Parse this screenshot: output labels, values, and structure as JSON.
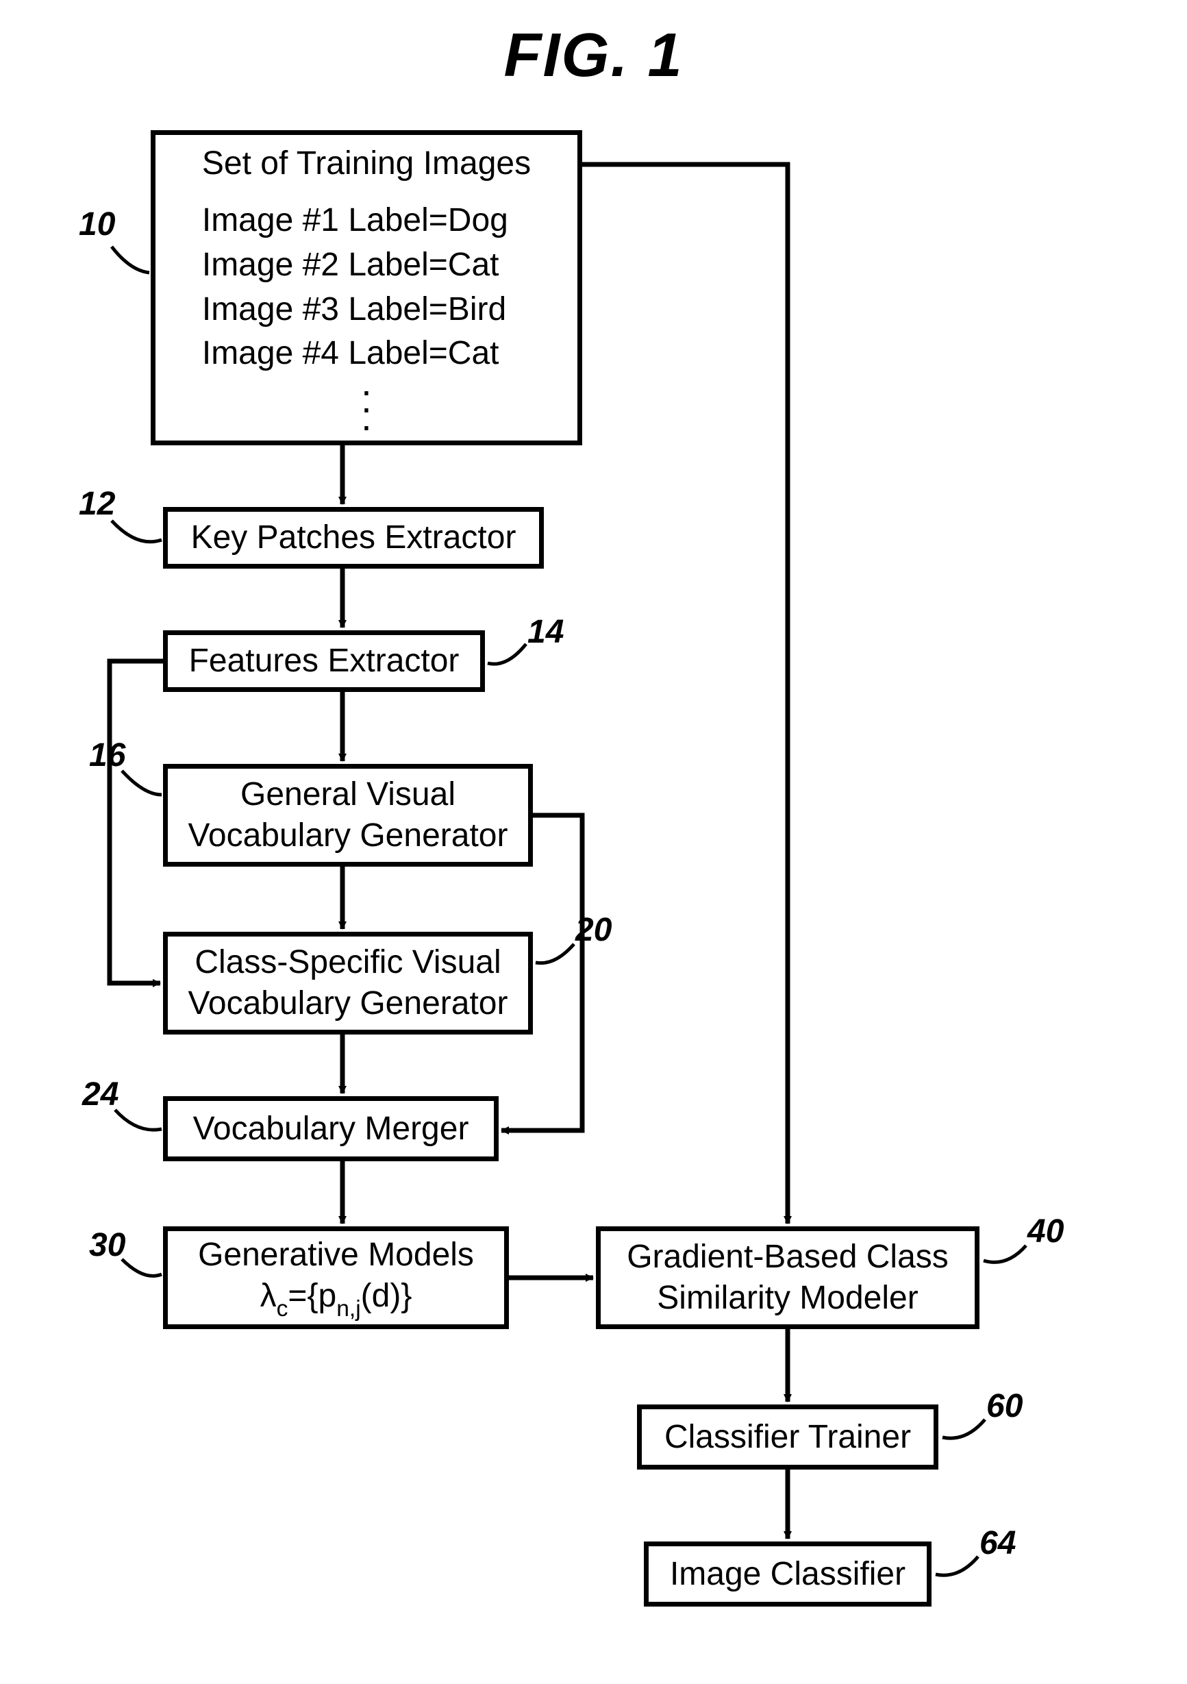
{
  "figure_title": "FIG. 1",
  "refs": {
    "r10": "10",
    "r12": "12",
    "r14": "14",
    "r16": "16",
    "r20": "20",
    "r24": "24",
    "r30": "30",
    "r40": "40",
    "r60": "60",
    "r64": "64"
  },
  "boxes": {
    "training_heading": "Set of Training Images",
    "training_lines": [
      "Image #1  Label=Dog",
      "Image #2  Label=Cat",
      "Image #3  Label=Bird",
      "Image #4  Label=Cat"
    ],
    "key_patches": "Key Patches Extractor",
    "features": "Features Extractor",
    "gen_vocab_l1": "General Visual",
    "gen_vocab_l2": "Vocabulary Generator",
    "cls_vocab_l1": "Class-Specific Visual",
    "cls_vocab_l2": "Vocabulary Generator",
    "vocab_merger": "Vocabulary Merger",
    "gen_models_l1": "Generative Models",
    "gen_models_l2_prefix": "λ",
    "gen_models_l2_sub": "c",
    "gen_models_l2_mid": "={p",
    "gen_models_l2_sub2": "n,j",
    "gen_models_l2_suffix": "(d)}",
    "grad_l1": "Gradient-Based Class",
    "grad_l2": "Similarity Modeler",
    "clf_trainer": "Classifier Trainer",
    "img_clf": "Image Classifier"
  }
}
